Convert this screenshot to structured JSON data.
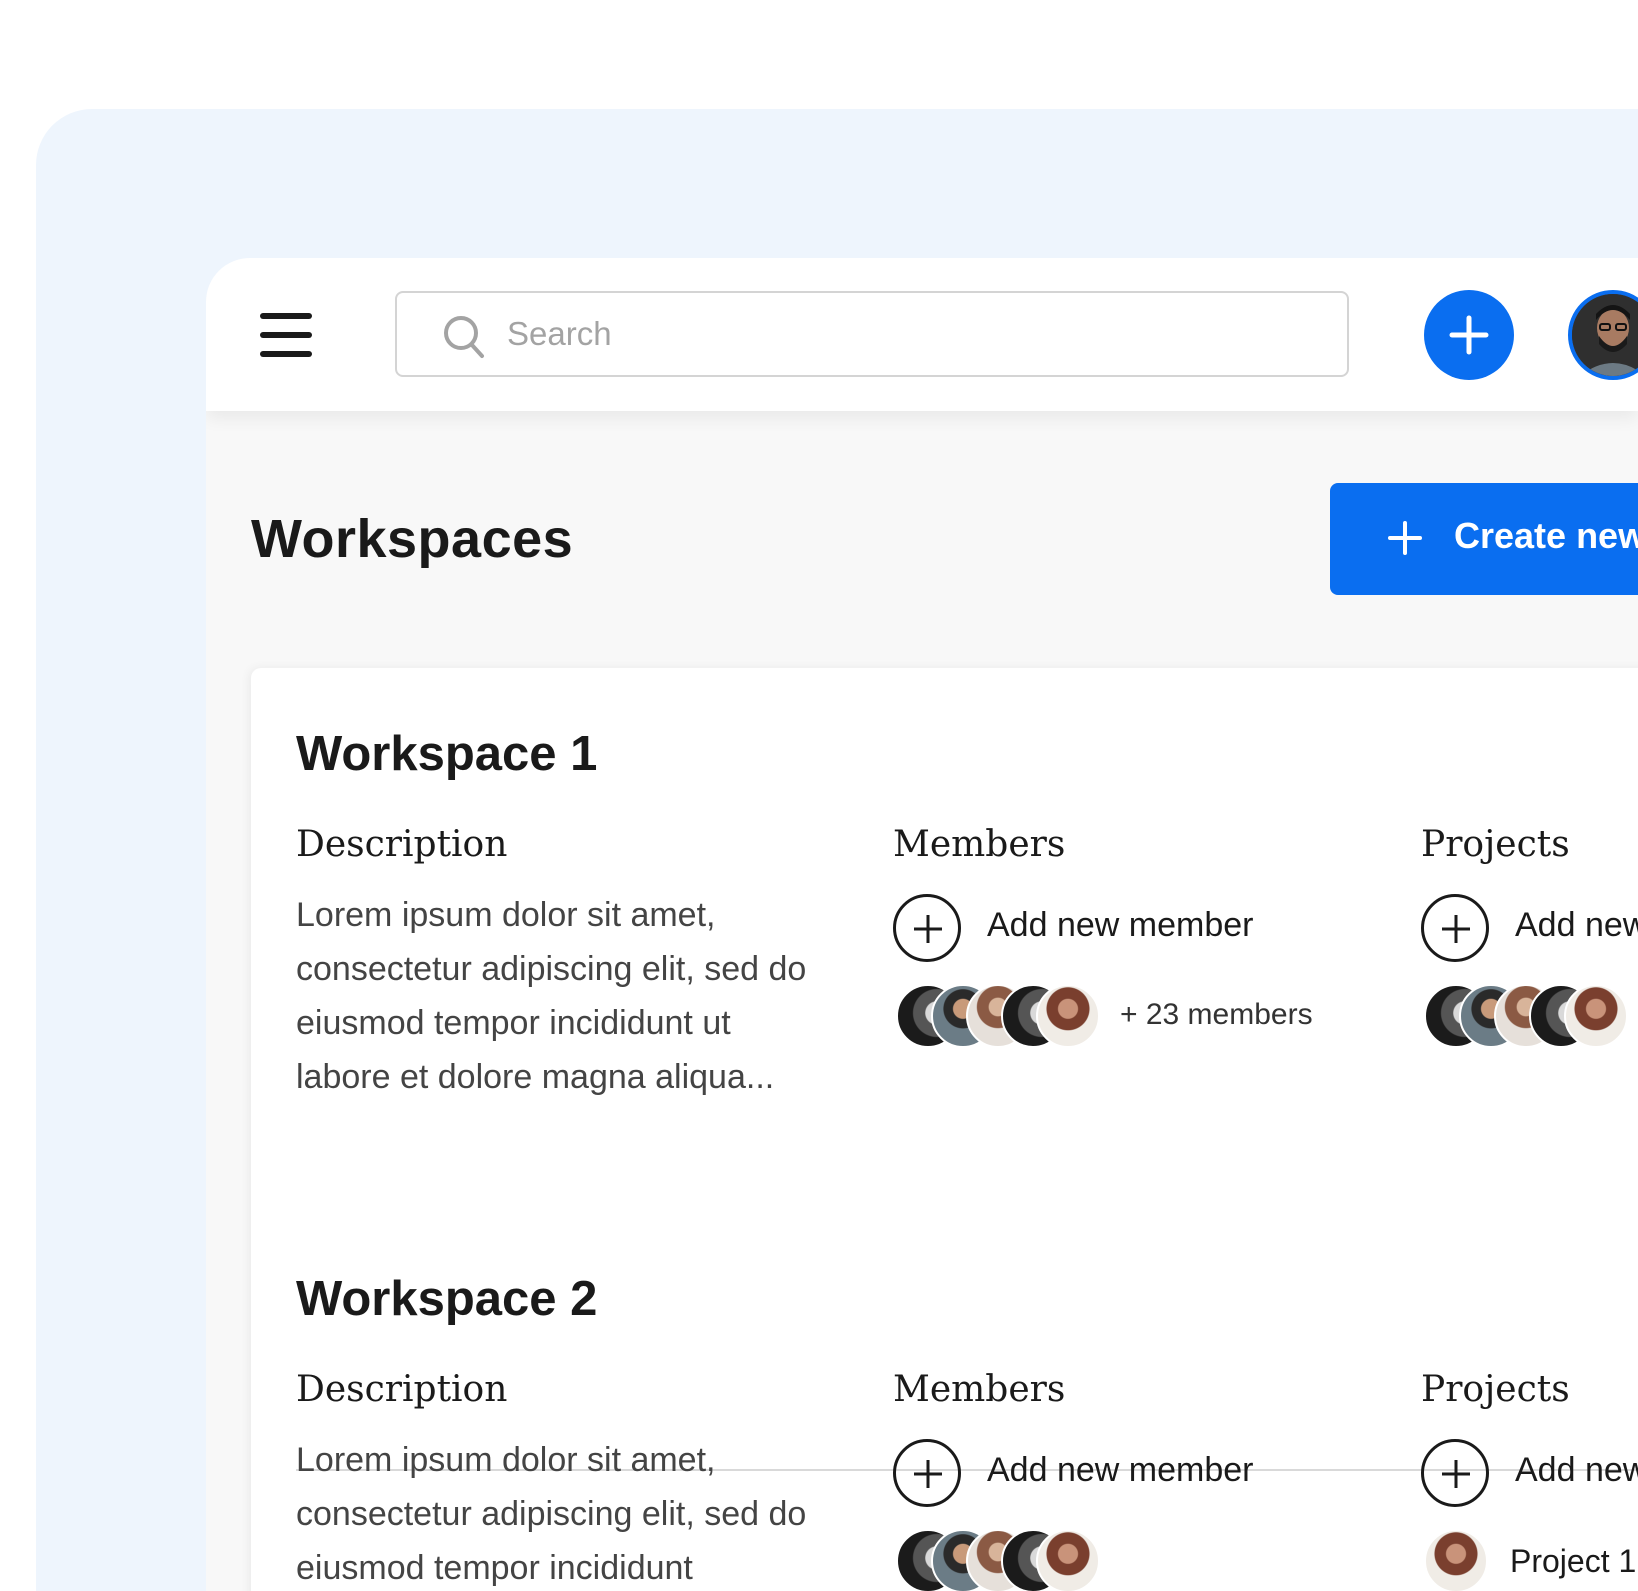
{
  "header": {
    "search_placeholder": "Search"
  },
  "page": {
    "title": "Workspaces",
    "create_label": "Create new"
  },
  "workspaces": [
    {
      "title": "Workspace 1",
      "description_heading": "Description",
      "description": "Lorem ipsum dolor sit amet, consectetur adipiscing elit, sed do eiusmod tempor incididunt ut labore et dolore magna aliqua...",
      "members_heading": "Members",
      "add_member_label": "Add new member",
      "members_more": "+ 23 members",
      "projects_heading": "Projects",
      "add_project_label": "Add new project"
    },
    {
      "title": "Workspace 2",
      "description_heading": "Description",
      "description": "Lorem ipsum dolor sit amet, consectetur adipiscing elit, sed do eiusmod tempor incididunt",
      "members_heading": "Members",
      "add_member_label": "Add new member",
      "projects_heading": "Projects",
      "add_project_label": "Add new project",
      "project_item": "Project 1"
    }
  ],
  "colors": {
    "accent": "#0a6ef0",
    "background_panel": "#eef5fd"
  }
}
